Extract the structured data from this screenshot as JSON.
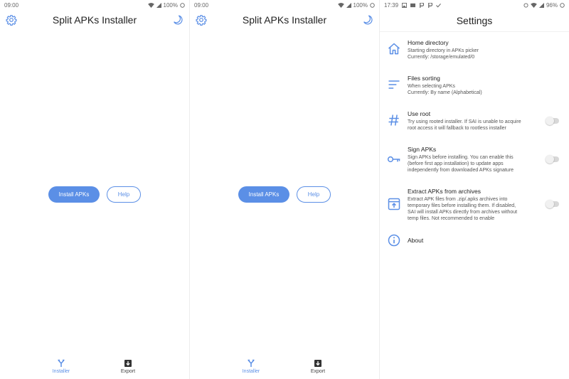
{
  "colors": {
    "accent": "#5b8fe6",
    "text": "#222222",
    "subtext": "#555555"
  },
  "screen1": {
    "status": {
      "time": "09:00",
      "battery": "100%"
    },
    "title": "Split APKs Installer",
    "install_label": "Install APKs",
    "help_label": "Help",
    "nav": {
      "installer": "Installer",
      "export": "Export"
    }
  },
  "screen2": {
    "status": {
      "time": "09:00",
      "battery": "100%"
    },
    "title": "Split APKs Installer",
    "install_label": "Install APKs",
    "help_label": "Help",
    "nav": {
      "installer": "Installer",
      "export": "Export"
    }
  },
  "screen3": {
    "status": {
      "time": "17:39",
      "battery": "96%"
    },
    "title": "Settings",
    "items": [
      {
        "title": "Home directory",
        "desc": [
          "Starting directory in APKs picker",
          "Currently: /storage/emulated/0"
        ],
        "icon": "home-icon"
      },
      {
        "title": "Files sorting",
        "desc": [
          "When selecting APKs",
          "Currently: By name (Alphabetical)"
        ],
        "icon": "sort-icon"
      },
      {
        "title": "Use root",
        "desc": [
          "Try using rooted installer. If SAI is unable to acquire",
          "root access it will fallback to rootless installer"
        ],
        "icon": "hash-icon"
      },
      {
        "title": "Sign APKs",
        "desc": [
          "Sign APKs before installing. You can enable this",
          "(before first app installation) to update apps",
          "independently from downloaded APKs signature"
        ],
        "icon": "key-icon"
      },
      {
        "title": "Extract APKs from archives",
        "desc": [
          "Extract APK files from .zip/.apks archives into",
          "temporary files before installing them. If disabled,",
          "SAI will install APKs directly from archives without",
          "temp files. Not recommended to enable"
        ],
        "icon": "archive-icon"
      },
      {
        "title": "About",
        "desc": [],
        "icon": "info-icon"
      }
    ]
  }
}
